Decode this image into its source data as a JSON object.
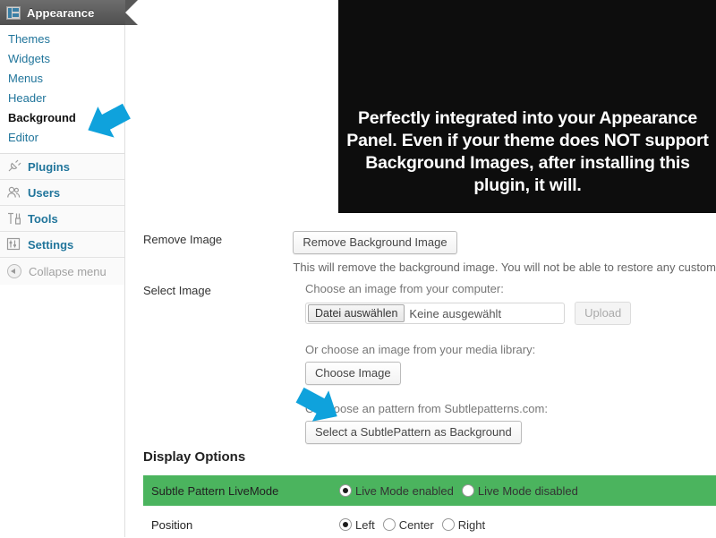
{
  "colors": {
    "accent_blue": "#0fa2dc",
    "link_blue": "#21759b",
    "highlight_green": "#4bb45e",
    "banner_bg": "#0d0d0d",
    "menu_header_gray": "#575757"
  },
  "sidebar": {
    "header": {
      "label": "Appearance",
      "icon": "appearance-icon"
    },
    "submenu": [
      {
        "label": "Themes",
        "active": false
      },
      {
        "label": "Widgets",
        "active": false
      },
      {
        "label": "Menus",
        "active": false
      },
      {
        "label": "Header",
        "active": false
      },
      {
        "label": "Background",
        "active": true
      },
      {
        "label": "Editor",
        "active": false
      }
    ],
    "menu": [
      {
        "label": "Plugins",
        "icon": "plug-icon"
      },
      {
        "label": "Users",
        "icon": "users-icon"
      },
      {
        "label": "Tools",
        "icon": "tools-icon"
      },
      {
        "label": "Settings",
        "icon": "sliders-icon"
      }
    ],
    "collapse": {
      "label": "Collapse menu",
      "icon": "collapse-arrow-icon"
    }
  },
  "banner": {
    "text": "Perfectly integrated into your Appearance Panel. Even if your theme does NOT support Background Images, after installing this plugin, it will."
  },
  "form": {
    "remove_image": {
      "label": "Remove Image",
      "button": "Remove Background Image",
      "help": "This will remove the background image. You will not be able to restore any custom"
    },
    "select_image": {
      "label": "Select Image",
      "computer_caption": "Choose an image from your computer:",
      "file_button": "Datei auswählen",
      "file_name": "Keine ausgewählt",
      "upload_button": "Upload",
      "library_caption": "Or choose an image from your media library:",
      "library_button": "Choose Image",
      "pattern_caption": "Or choose an pattern from Subtlepatterns.com:",
      "pattern_button": "Select a SubtlePattern as Background"
    }
  },
  "display_options": {
    "title": "Display Options",
    "rows": [
      {
        "label": "Subtle Pattern LiveMode",
        "highlighted": true,
        "options": [
          {
            "label": "Live Mode enabled",
            "checked": true
          },
          {
            "label": "Live Mode disabled",
            "checked": false
          }
        ]
      },
      {
        "label": "Position",
        "highlighted": false,
        "options": [
          {
            "label": "Left",
            "checked": true
          },
          {
            "label": "Center",
            "checked": false
          },
          {
            "label": "Right",
            "checked": false
          }
        ]
      }
    ]
  },
  "pointers": [
    {
      "name": "pointer-background-menu",
      "direction": "up-left"
    },
    {
      "name": "pointer-subtlepattern-button",
      "direction": "down-right"
    }
  ]
}
